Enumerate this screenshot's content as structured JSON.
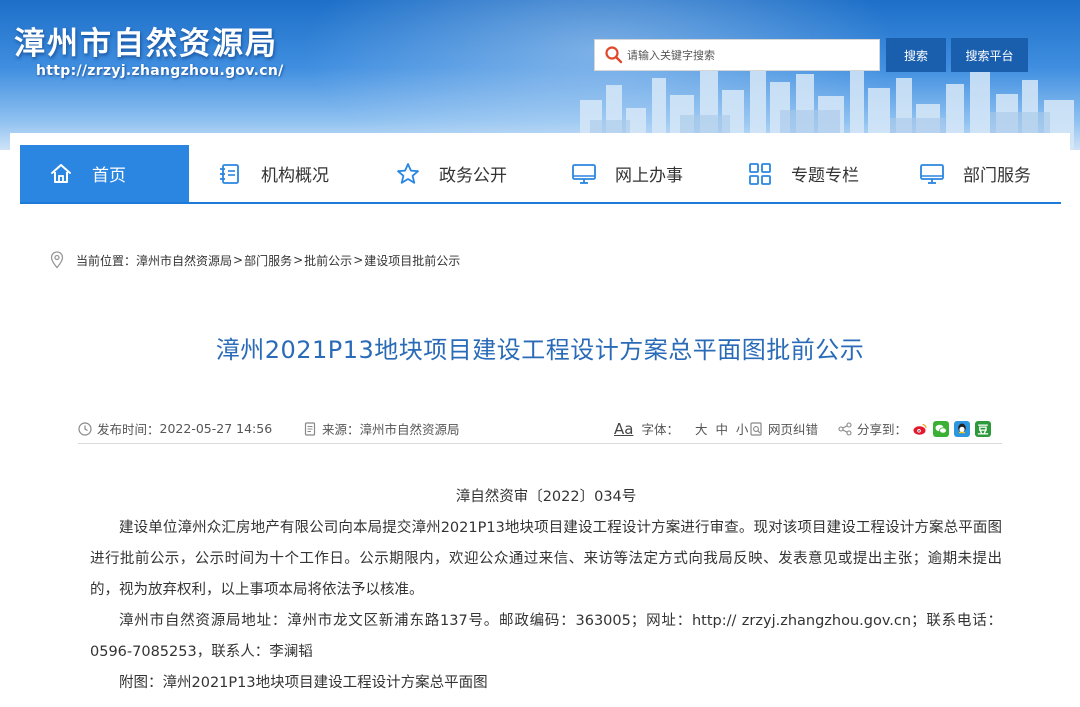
{
  "header": {
    "site_title": "漳州市自然资源局",
    "site_url": "http://zrzyj.zhangzhou.gov.cn/",
    "search_placeholder": "请输入关键字搜索",
    "search_button": "搜索",
    "platform_button": "搜索平台"
  },
  "nav": {
    "items": [
      {
        "label": "首页",
        "icon": "home-icon",
        "active": true
      },
      {
        "label": "机构概况",
        "icon": "document-list-icon"
      },
      {
        "label": "政务公开",
        "icon": "star-icon"
      },
      {
        "label": "网上办事",
        "icon": "monitor-icon"
      },
      {
        "label": "专题专栏",
        "icon": "grid-icon"
      },
      {
        "label": "部门服务",
        "icon": "monitor-icon"
      }
    ]
  },
  "breadcrumb": {
    "prefix": "当前位置：",
    "items": [
      "漳州市自然资源局",
      "部门服务",
      "批前公示",
      "建设项目批前公示"
    ],
    "separator": ">"
  },
  "article": {
    "title": "漳州2021P13地块项目建设工程设计方案总平面图批前公示",
    "meta": {
      "date_label": "发布时间：",
      "date": "2022-05-27 14:56",
      "source_label": "来源：",
      "source": "漳州市自然资源局",
      "font_label": "字体：",
      "font_sizes": "大 中 小",
      "font_icon_text": "Aa",
      "error_label": "网页纠错",
      "share_label": "分享到："
    },
    "doc_number": "漳自然资审〔2022〕034号",
    "paragraphs": [
      "建设单位漳州众汇房地产有限公司向本局提交漳州2021P13地块项目建设工程设计方案进行审查。现对该项目建设工程设计方案总平面图进行批前公示，公示时间为十个工作日。公示期限内，欢迎公众通过来信、来访等法定方式向我局反映、发表意见或提出主张；逾期未提出的，视为放弃权利，以上事项本局将依法予以核准。",
      "漳州市自然资源局地址：漳州市龙文区新浦东路137号。邮政编码：363005；网址：http:// zrzyj.zhangzhou.gov.cn；联系电话：0596-7085253，联系人：李澜韬",
      "附图：漳州2021P13地块项目建设工程设计方案总平面图"
    ]
  },
  "colors": {
    "brand_blue": "#1a5eae",
    "nav_active": "#2a86e0",
    "title_blue": "#2a6bb8"
  }
}
